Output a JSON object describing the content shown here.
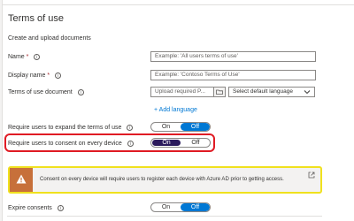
{
  "section_title": "Terms of use",
  "subtitle": "Create and upload documents",
  "fields": {
    "name": {
      "label": "Name",
      "required_mark": "*",
      "placeholder": "Example: 'All users terms of use'"
    },
    "display_name": {
      "label": "Display name",
      "required_mark": "*",
      "placeholder": "Example: 'Contoso Terms of Use'"
    },
    "terms_document": {
      "label": "Terms of use document",
      "upload_placeholder": "Upload required P...",
      "language_select": "Select default language"
    }
  },
  "add_language_link": "+ Add language",
  "settings": {
    "expand_terms": {
      "label": "Require users to expand the terms of use",
      "on": "On",
      "off": "Off",
      "selected": "Off"
    },
    "consent_every_device": {
      "label": "Require users to consent on every device",
      "on": "On",
      "off": "Off",
      "selected": "On"
    },
    "expire_consents": {
      "label": "Expire consents",
      "on": "On",
      "off": "Off",
      "selected": "Off"
    }
  },
  "banner": {
    "text": "Consent on every device will require users to register each device with Azure AD prior to getting access.",
    "icon": "warning-icon",
    "link_icon": "external-link-icon"
  },
  "info_glyph": "i",
  "colors": {
    "accent": "#0078d4",
    "toggle_selected_dark": "#2b1a5c",
    "highlight_red": "#e01b24",
    "highlight_yellow": "#f0e11e",
    "warning": "#c7703a"
  }
}
